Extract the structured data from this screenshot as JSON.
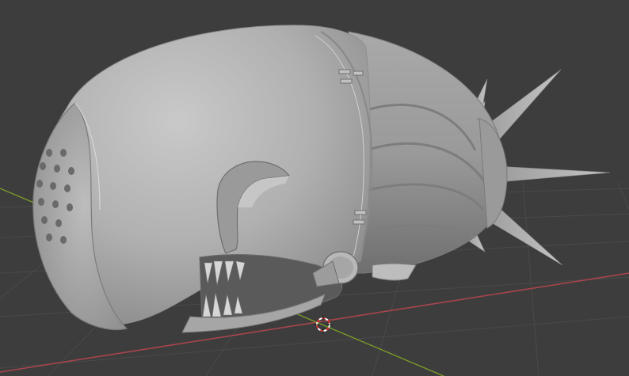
{
  "viewport": {
    "background": "#3d3d3d",
    "grid_color": "#4a4a4a",
    "x_axis_color": "#a8454c",
    "y_axis_color": "#7a9a2a",
    "mesh_color": "#b2b2b2"
  },
  "scene": {
    "object": "creature-head-mesh",
    "cursor": "3d-cursor-icon"
  }
}
